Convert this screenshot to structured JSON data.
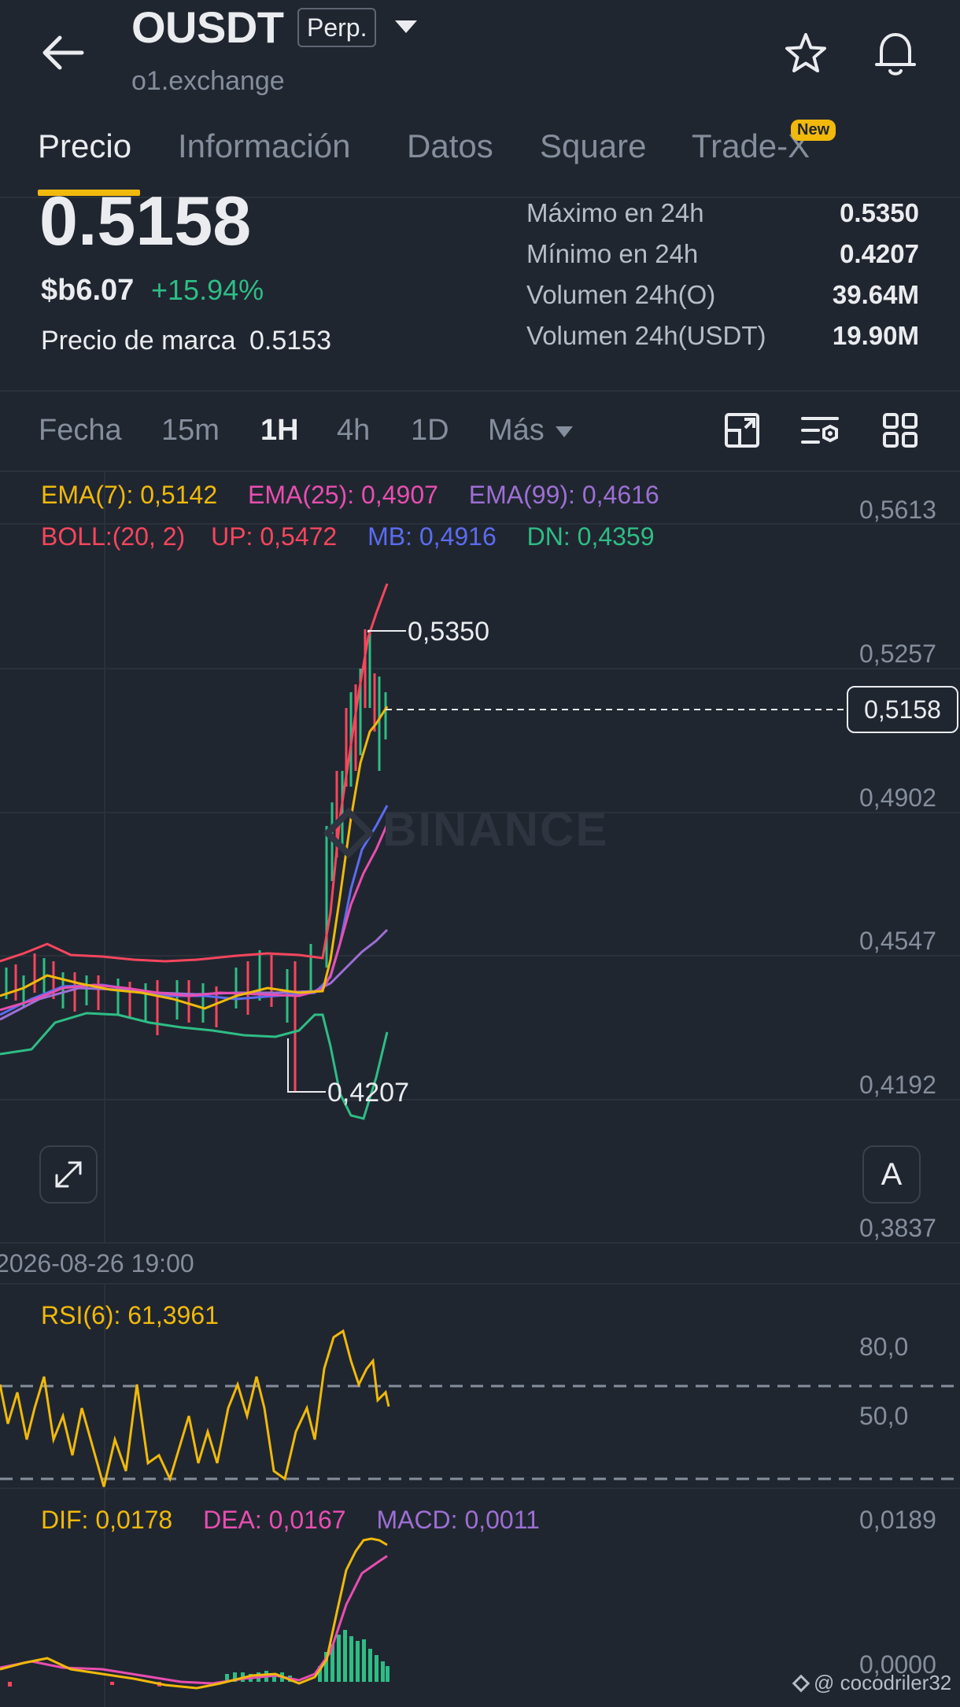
{
  "header": {
    "symbol": "OUSDT",
    "badge": "Perp.",
    "subtitle": "o1.exchange"
  },
  "tabs": [
    {
      "label": "Precio",
      "active": true
    },
    {
      "label": "Información",
      "active": false
    },
    {
      "label": "Datos",
      "active": false
    },
    {
      "label": "Square",
      "active": false
    },
    {
      "label": "Trade-X",
      "active": false,
      "badge": "New"
    }
  ],
  "price": {
    "last": "0.5158",
    "usd": "$b6.07",
    "change": "+15.94%",
    "mark_label": "Precio de marca",
    "mark_value": "0.5153"
  },
  "stats": [
    {
      "label": "Máximo en 24h",
      "value": "0.5350"
    },
    {
      "label": "Mínimo en 24h",
      "value": "0.4207"
    },
    {
      "label": "Volumen 24h(O)",
      "value": "39.64M"
    },
    {
      "label": "Volumen 24h(USDT)",
      "value": "19.90M"
    }
  ],
  "intervals": [
    {
      "label": "Fecha",
      "active": false
    },
    {
      "label": "15m",
      "active": false
    },
    {
      "label": "1H",
      "active": true
    },
    {
      "label": "4h",
      "active": false
    },
    {
      "label": "1D",
      "active": false
    },
    {
      "label": "Más",
      "active": false
    }
  ],
  "indicators": {
    "ema7": "EMA(7): 0,5142",
    "ema25": "EMA(25): 0,4907",
    "ema99": "EMA(99): 0,4616",
    "boll": "BOLL:(20, 2)",
    "up": "UP: 0,5472",
    "mb": "MB: 0,4916",
    "dn": "DN: 0,4359"
  },
  "price_axis": [
    "0,5613",
    "0,5257",
    "0,4902",
    "0,4547",
    "0,4192",
    "0,3837"
  ],
  "current_price_tag": "0,5158",
  "high_marker": "0,5350",
  "low_marker": "0,4207",
  "watermark": "BINANCE",
  "time_label": "2026-08-26 19:00",
  "font_button": "A",
  "rsi": {
    "label": "RSI(6): 61,3961",
    "axis": [
      "80,0",
      "50,0"
    ]
  },
  "macd": {
    "dif": "DIF: 0,0178",
    "dea": "DEA: 0,0167",
    "macd": "MACD: 0,0011",
    "axis": [
      "0,0189",
      "0,0000"
    ]
  },
  "footer_watermark": "@ cocodriler32",
  "colors": {
    "ema7": "#f0b90b",
    "ema25": "#e84eb0",
    "ema99": "#9d6fd4",
    "boll": "#f6465d",
    "mb": "#5b6cf0",
    "dn": "#2ebd85",
    "up_candle": "#2ebd85",
    "down_candle": "#f6465d",
    "accent": "#f0b90b"
  }
}
